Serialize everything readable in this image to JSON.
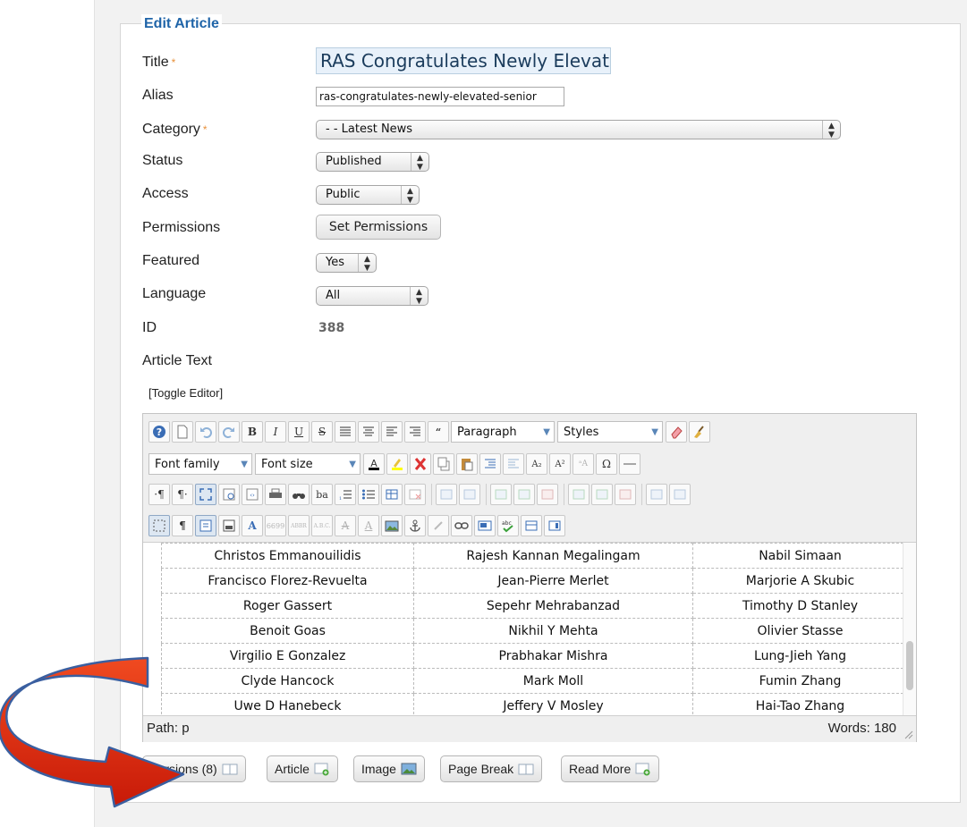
{
  "form": {
    "legend": "Edit Article",
    "required_mark": "*",
    "title_label": "Title",
    "title_value": "RAS Congratulates Newly Elevated",
    "alias_label": "Alias",
    "alias_value": "ras-congratulates-newly-elevated-senior",
    "category_label": "Category",
    "category_value": "- - Latest News",
    "status_label": "Status",
    "status_value": "Published",
    "access_label": "Access",
    "access_value": "Public",
    "permissions_label": "Permissions",
    "permissions_button": "Set Permissions",
    "featured_label": "Featured",
    "featured_value": "Yes",
    "language_label": "Language",
    "language_value": "All",
    "id_label": "ID",
    "id_value": "388",
    "article_text_label": "Article Text",
    "toggle_editor": "[Toggle Editor]"
  },
  "toolbar": {
    "format_select": "Paragraph",
    "styles_select": "Styles",
    "font_family_select": "Font family",
    "font_size_select": "Font size"
  },
  "name_table": {
    "rows": [
      [
        "Christos Emmanouilidis",
        "Rajesh Kannan Megalingam",
        "Nabil Simaan"
      ],
      [
        "Francisco Florez-Revuelta",
        "Jean-Pierre Merlet",
        "Marjorie A Skubic"
      ],
      [
        "Roger Gassert",
        "Sepehr Mehrabanzad",
        "Timothy D Stanley"
      ],
      [
        "Benoit Goas",
        "Nikhil Y Mehta",
        "Olivier Stasse"
      ],
      [
        "Virgilio E Gonzalez",
        "Prabhakar Mishra",
        "Lung-Jieh Yang"
      ],
      [
        "Clyde Hancock",
        "Mark Moll",
        "Fumin Zhang"
      ],
      [
        "Uwe D Hanebeck",
        "Jeffery V Mosley",
        "Hai-Tao Zhang"
      ]
    ]
  },
  "status_bar": {
    "path": "Path: p",
    "words": "Words: 180"
  },
  "buttons": {
    "versions": "Versions (8)",
    "article": "Article",
    "image": "Image",
    "page_break": "Page Break",
    "read_more": "Read More"
  },
  "colors": {
    "legend": "#1f64a8",
    "required": "#e8913b",
    "arrow": "#e1260f"
  }
}
